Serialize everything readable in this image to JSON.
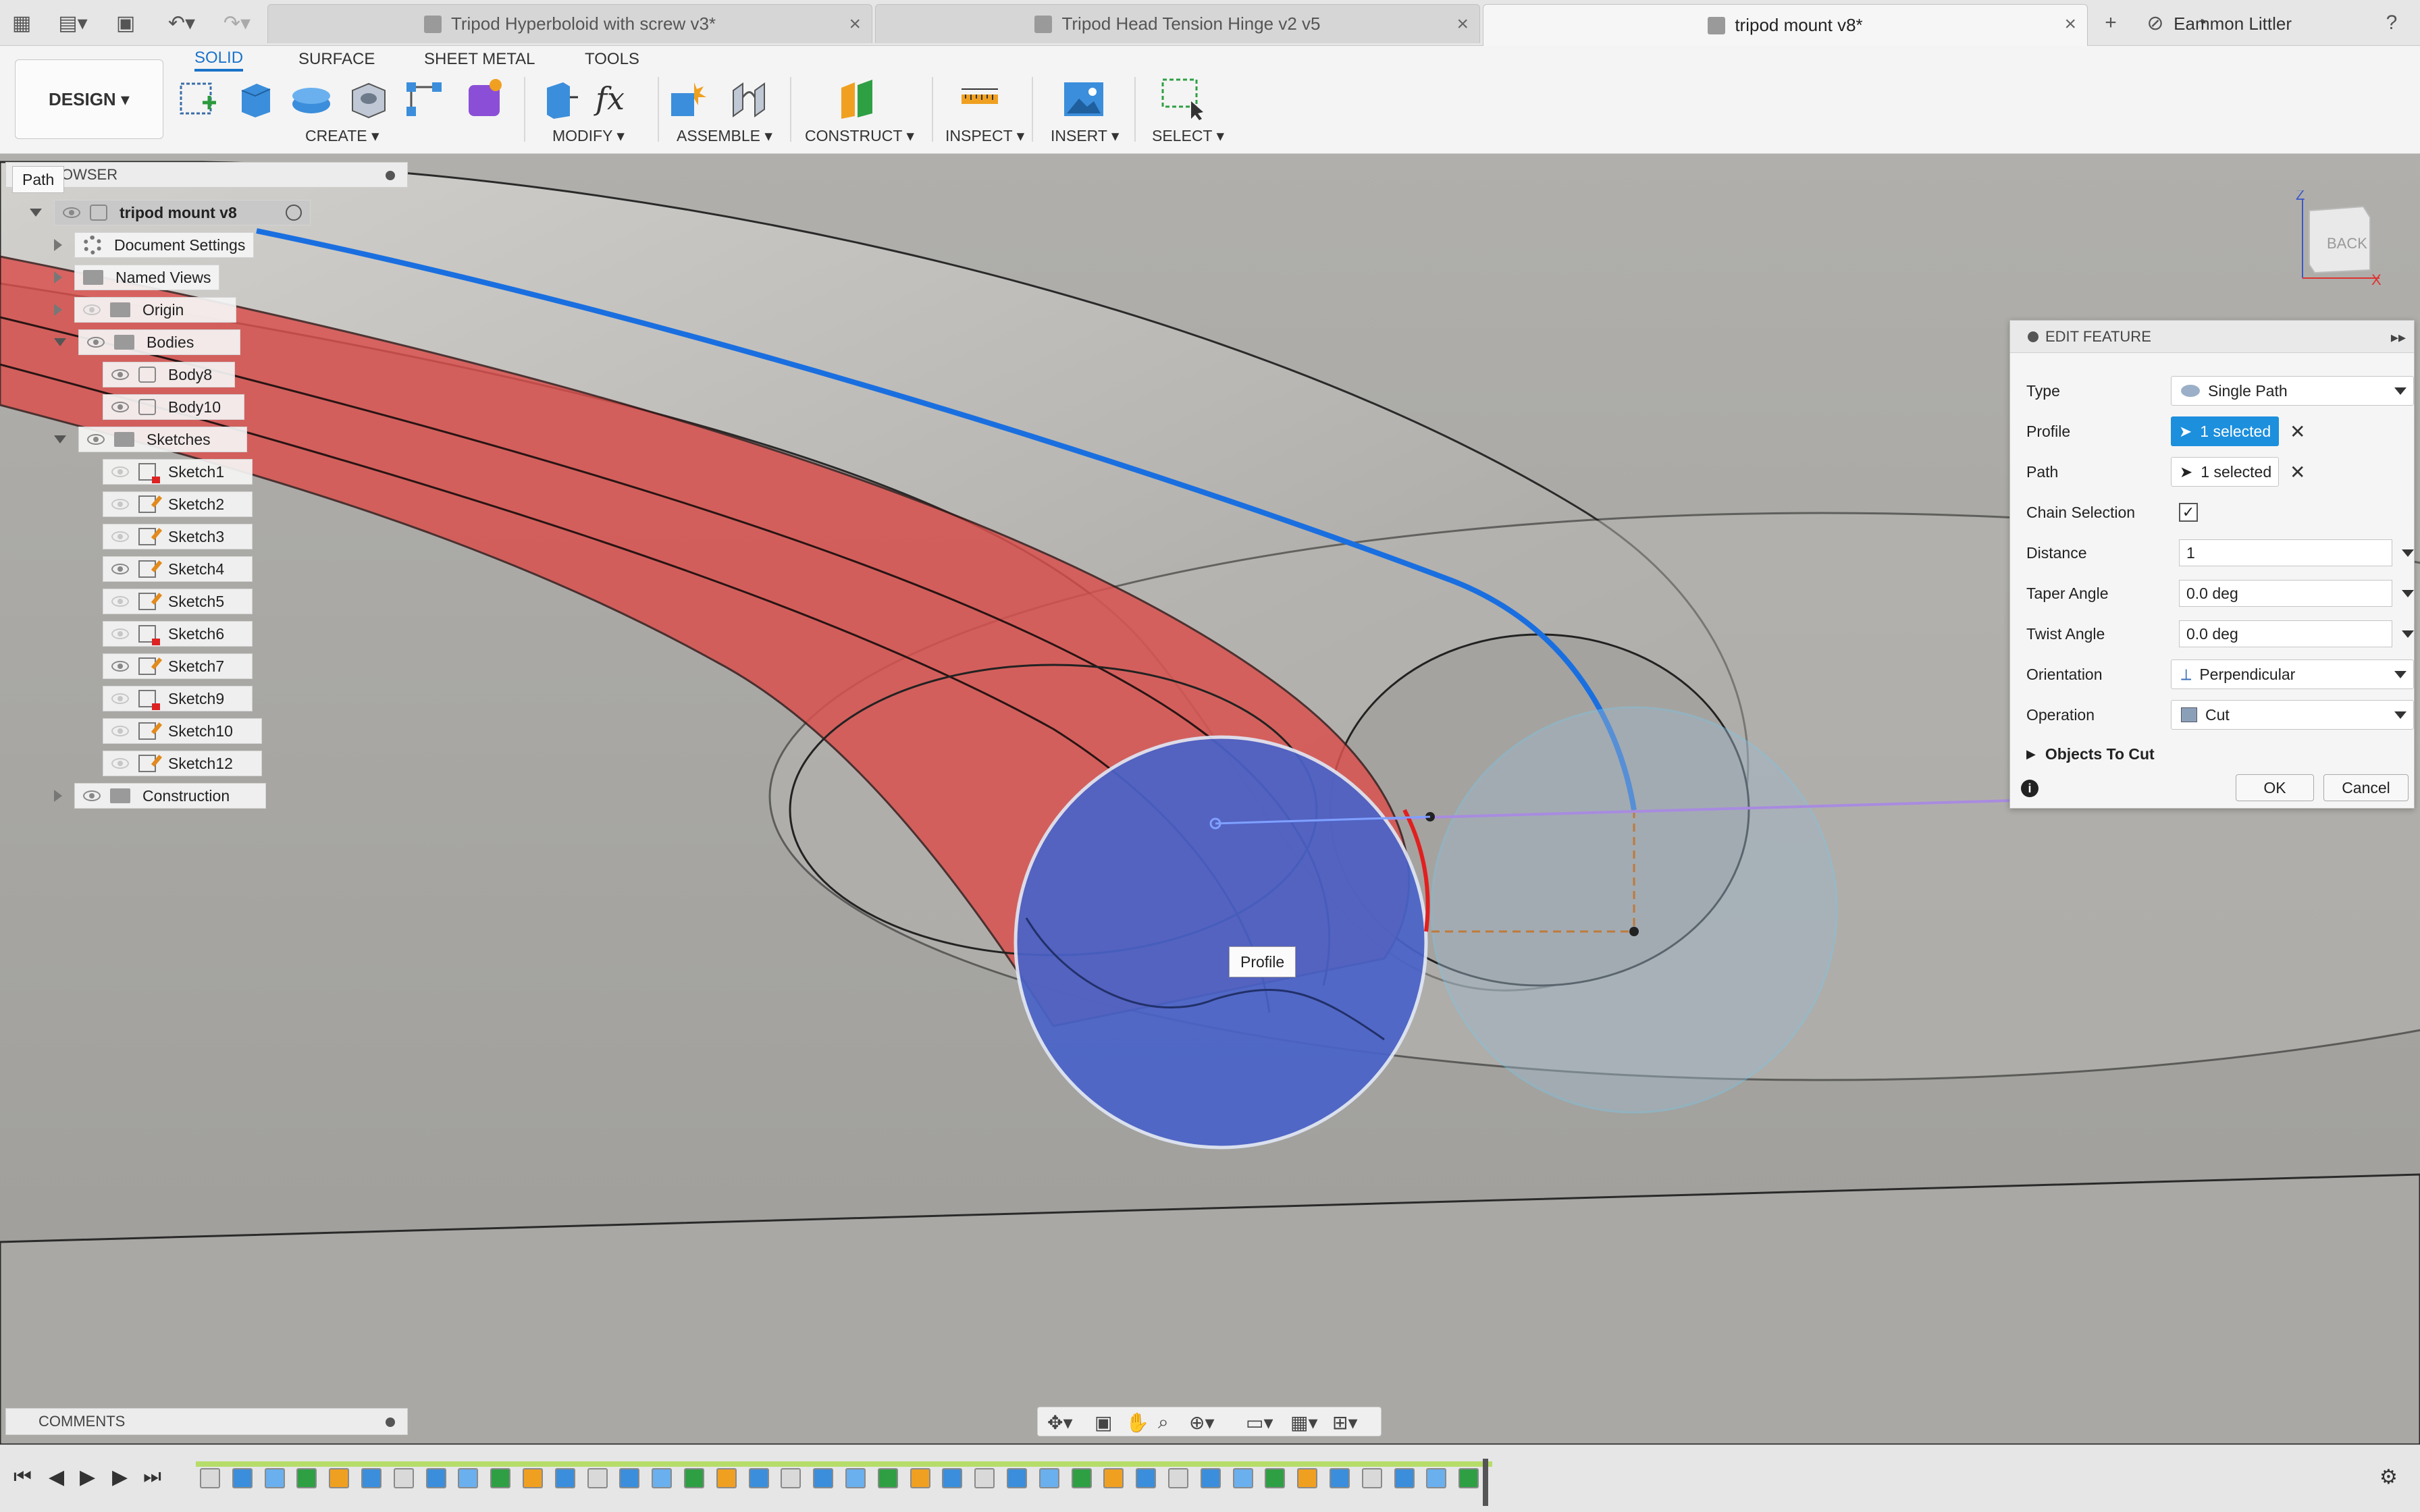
{
  "toolbar": {
    "tabs": [
      {
        "label": "Tripod Hyperboloid with screw v3*"
      },
      {
        "label": "Tripod Head Tension Hinge v2 v5"
      },
      {
        "label": "tripod mount v8*"
      }
    ],
    "user": "Eammon Littler"
  },
  "ribbon": {
    "workspace": "DESIGN",
    "tabs": [
      "SOLID",
      "SURFACE",
      "SHEET METAL",
      "TOOLS"
    ],
    "groups": [
      "CREATE",
      "MODIFY",
      "ASSEMBLE",
      "CONSTRUCT",
      "INSPECT",
      "INSERT",
      "SELECT"
    ]
  },
  "browser": {
    "header": "OWSER",
    "tooltip": "Path",
    "root": "tripod mount v8",
    "items": [
      {
        "label": "Document Settings"
      },
      {
        "label": "Named Views"
      },
      {
        "label": "Origin"
      },
      {
        "label": "Bodies"
      },
      {
        "label": "Body8"
      },
      {
        "label": "Body10"
      },
      {
        "label": "Sketches"
      },
      {
        "label": "Sketch1"
      },
      {
        "label": "Sketch2"
      },
      {
        "label": "Sketch3"
      },
      {
        "label": "Sketch4"
      },
      {
        "label": "Sketch5"
      },
      {
        "label": "Sketch6"
      },
      {
        "label": "Sketch7"
      },
      {
        "label": "Sketch9"
      },
      {
        "label": "Sketch10"
      },
      {
        "label": "Sketch12"
      },
      {
        "label": "Construction"
      }
    ]
  },
  "viewcube": {
    "face": "BACK",
    "z": "Z",
    "x": "X"
  },
  "edit_feature": {
    "title": "EDIT FEATURE",
    "type_label": "Type",
    "type_value": "Single Path",
    "profile_label": "Profile",
    "profile_value": "1 selected",
    "path_label": "Path",
    "path_value": "1 selected",
    "chain_label": "Chain Selection",
    "chain_checked": "✓",
    "distance_label": "Distance",
    "distance_value": "1",
    "taper_label": "Taper Angle",
    "taper_value": "0.0 deg",
    "twist_label": "Twist Angle",
    "twist_value": "0.0 deg",
    "orientation_label": "Orientation",
    "orientation_value": "Perpendicular",
    "operation_label": "Operation",
    "operation_value": "Cut",
    "objects_label": "Objects To Cut",
    "ok": "OK",
    "cancel": "Cancel"
  },
  "viewport": {
    "profile_label": "Profile"
  },
  "comments": {
    "label": "COMMENTS"
  },
  "colors": {
    "accent": "#1c8fdd",
    "profile_fill": "#4a63c9",
    "path_line": "#1a6fe0",
    "red_body": "#d9524f"
  }
}
